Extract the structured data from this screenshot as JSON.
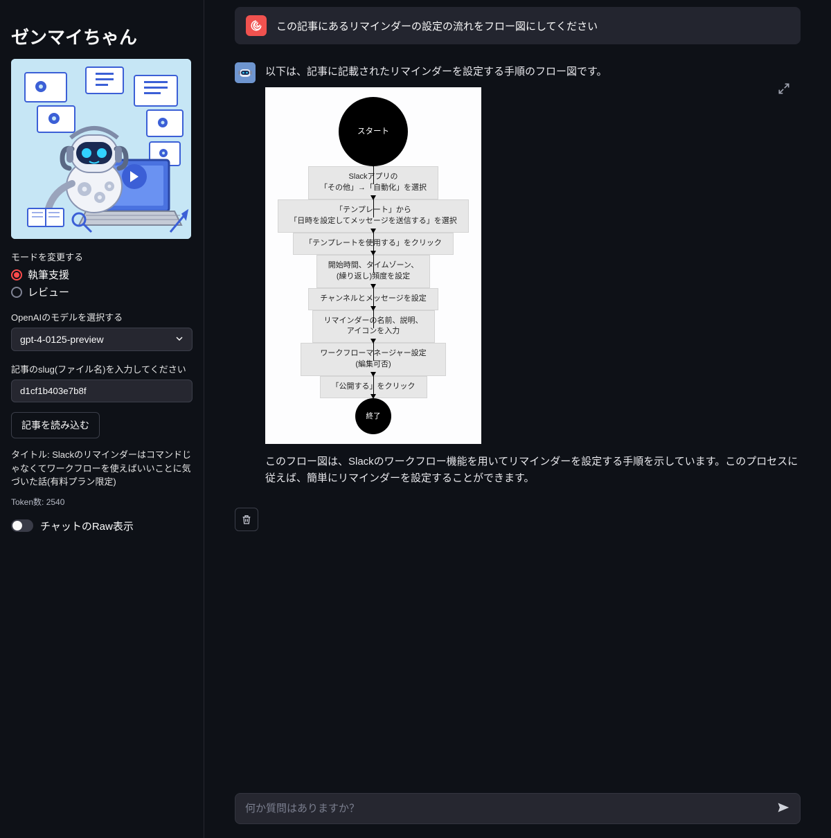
{
  "sidebar": {
    "title": "ゼンマイちゃん",
    "mode_label": "モードを変更する",
    "mode_options": [
      {
        "label": "執筆支援",
        "value": "write",
        "checked": true
      },
      {
        "label": "レビュー",
        "value": "review",
        "checked": false
      }
    ],
    "model_label": "OpenAIのモデルを選択する",
    "model_selected": "gpt-4-0125-preview",
    "slug_label": "記事のslug(ファイル名)を入力してください",
    "slug_value": "d1cf1b403e7b8f",
    "load_button": "記事を読み込む",
    "title_text": "タイトル: Slackのリマインダーはコマンドじゃなくてワークフローを使えばいいことに気づいた話(有料プラン限定)",
    "token_text": "Token数: 2540",
    "toggle_label": "チャットのRaw表示",
    "toggle_on": false
  },
  "chat": {
    "user_avatar_icon": "spiral-icon",
    "user_message": "この記事にあるリマインダーの設定の流れをフロー図にしてください",
    "bot_intro": "以下は、記事に記載されたリマインダーを設定する手順のフロー図です。",
    "diagram": {
      "start": "スタート",
      "steps": [
        {
          "l1": "Slackアプリの",
          "l2": "「その他」→「自動化」を選択",
          "cls": ""
        },
        {
          "l1": "「テンプレート」から",
          "l2": "「日時を設定してメッセージを送信する」を選択",
          "cls": "wide"
        },
        {
          "l1": "「テンプレートを使用する」をクリック",
          "l2": "",
          "cls": "med"
        },
        {
          "l1": "開始時間、タイムゾーン、",
          "l2": "(繰り返し)頻度を設定",
          "cls": ""
        },
        {
          "l1": "チャンネルとメッセージを設定",
          "l2": "",
          "cls": ""
        },
        {
          "l1": "リマインダーの名前、説明、",
          "l2": "アイコンを入力",
          "cls": ""
        },
        {
          "l1": "ワークフローマネージャー設定",
          "l2": "(編集可否)",
          "cls": "med"
        },
        {
          "l1": "「公開する」をクリック",
          "l2": "",
          "cls": "narrow"
        }
      ],
      "end": "終了"
    },
    "bot_outro": "このフロー図は、Slackのワークフロー機能を用いてリマインダーを設定する手順を示しています。このプロセスに従えば、簡単にリマインダーを設定することができます。",
    "input_placeholder": "何か質問はありますか？"
  }
}
